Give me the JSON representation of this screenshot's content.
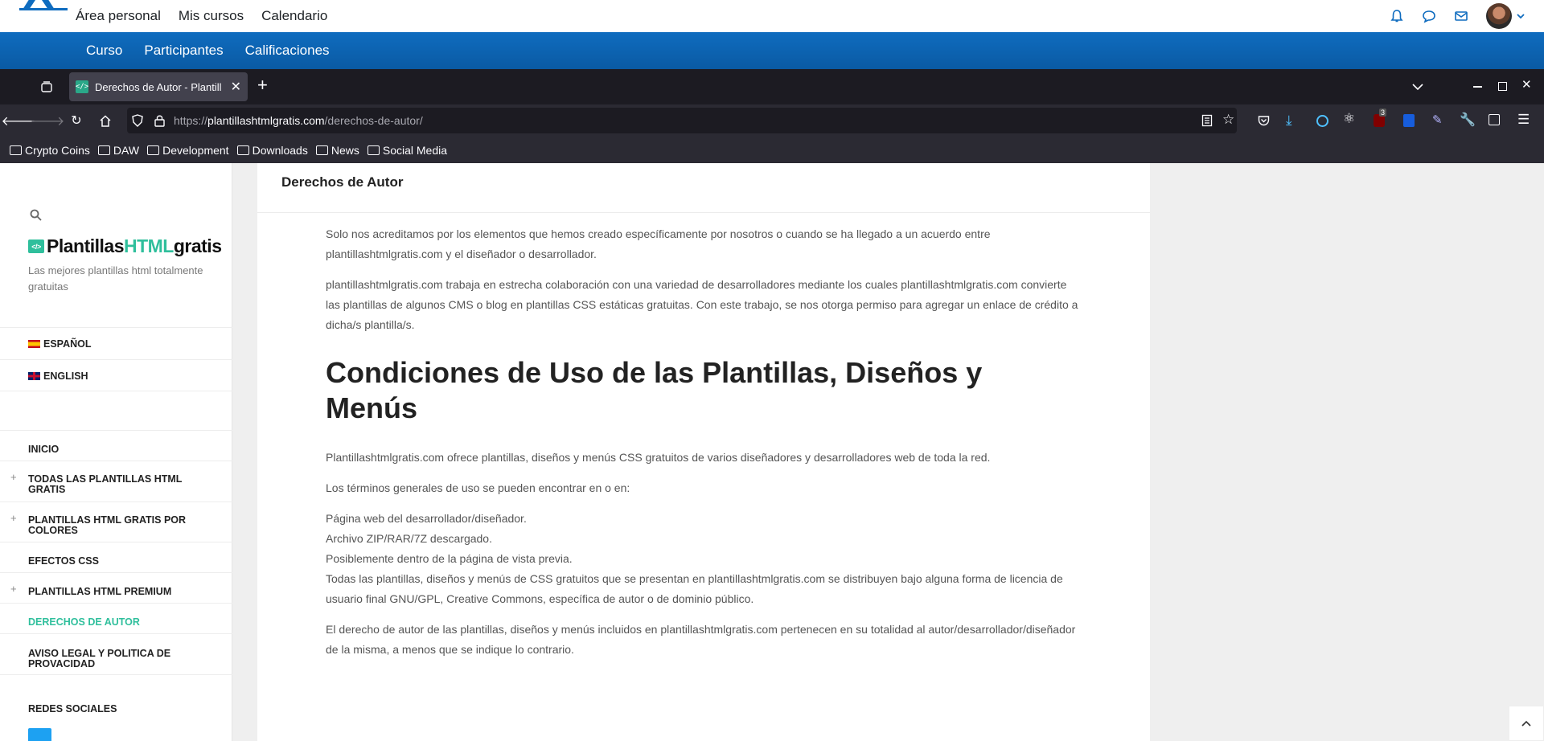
{
  "topnav": {
    "links": [
      "Área personal",
      "Mis cursos",
      "Calendario"
    ]
  },
  "coursebar": {
    "links": [
      "Curso",
      "Participantes",
      "Calificaciones"
    ]
  },
  "browser": {
    "tab_title": "Derechos de Autor - Plantill",
    "url_prefix": "https://",
    "url_host": "plantillashtmlgratis.com",
    "url_path": "/derechos-de-autor/",
    "extension_badge": "3",
    "bookmarks": [
      "Crypto Coins",
      "DAW",
      "Development",
      "Downloads",
      "News",
      "Social Media"
    ]
  },
  "sidebar": {
    "logo_part1": "Plantillas",
    "logo_part2": "HTML",
    "logo_part3": "gratis",
    "tagline": "Las mejores plantillas html totalmente gratuitas",
    "languages": [
      "ESPAÑOL",
      "ENGLISH"
    ],
    "menu": [
      "INICIO",
      "TODAS LAS PLANTILLAS HTML GRATIS",
      "PLANTILLAS HTML GRATIS POR COLORES",
      "EFECTOS CSS",
      "PLANTILLAS HTML PREMIUM",
      "DERECHOS DE AUTOR",
      "AVISO LEGAL Y POLITICA DE PROVACIDAD"
    ],
    "social_title": "REDES SOCIALES"
  },
  "main": {
    "header": "Derechos de Autor",
    "p1": "Solo nos acreditamos por los elementos que hemos creado específicamente por nosotros o cuando se ha llegado a un acuerdo entre plantillashtmlgratis.com y el diseñador o desarrollador.",
    "p2": "plantillashtmlgratis.com trabaja en estrecha colaboración con una variedad de desarrolladores mediante los cuales plantillashtmlgratis.com convierte las plantillas de algunos CMS o blog en plantillas CSS estáticas gratuitas. Con este trabajo, se nos otorga permiso para agregar un enlace de crédito a dicha/s plantilla/s.",
    "h1": "Condiciones de Uso de las Plantillas, Diseños y Menús",
    "p3": "Plantillashtmlgratis.com ofrece plantillas, diseños y menús CSS gratuitos de varios diseñadores y desarrolladores web de toda la red.",
    "p4": "Los términos generales de uso se pueden encontrar en o en:",
    "l1": "Página web del desarrollador/diseñador.",
    "l2": "Archivo ZIP/RAR/7Z descargado.",
    "l3": "Posiblemente dentro de la página de vista previa.",
    "l4": "Todas las plantillas, diseños y menús de CSS gratuitos que se presentan en plantillashtmlgratis.com se distribuyen bajo alguna forma de licencia de usuario final GNU/GPL, Creative Commons, específica de autor o de dominio público.",
    "p5": "El derecho de autor de las plantillas, diseños y menús incluidos en plantillashtmlgratis.com pertenecen en su totalidad al autor/desarrollador/diseñador de la misma, a menos que se indique lo contrario."
  },
  "colors": {
    "moodle_blue": "#0f6cbf",
    "accent_teal": "#2fbf9c",
    "browser_dark": "#1c1b22"
  }
}
